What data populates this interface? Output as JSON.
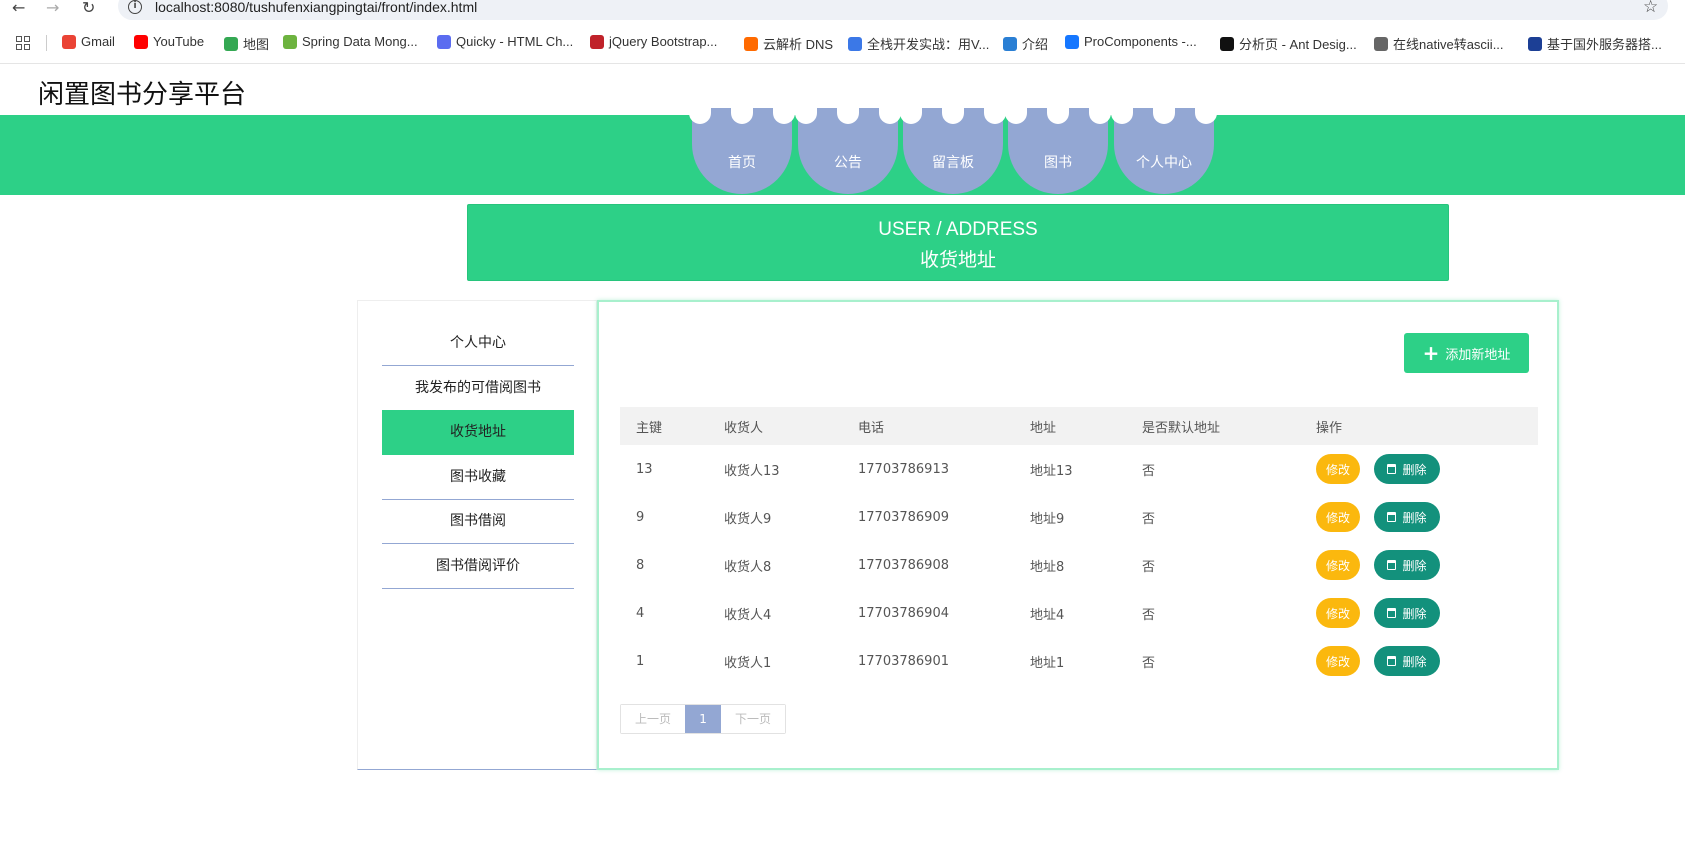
{
  "browser": {
    "url": "localhost:8080/tushufenxiangpingtai/front/index.html",
    "bookmarks": [
      {
        "label": "Gmail",
        "icon": "gmail-icon",
        "color": "#ea4335"
      },
      {
        "label": "YouTube",
        "icon": "youtube-icon",
        "color": "#ff0000"
      },
      {
        "label": "地图",
        "icon": "maps-icon",
        "color": "#34a853"
      },
      {
        "label": "Spring Data Mong...",
        "icon": "spring-icon",
        "color": "#6db33f"
      },
      {
        "label": "Quicky - HTML Ch...",
        "icon": "quicky-icon",
        "color": "#5b6cf0"
      },
      {
        "label": "jQuery Bootstrap...",
        "icon": "jquery-icon",
        "color": "#c0222a"
      },
      {
        "label": "云解析 DNS",
        "icon": "aliyun-icon",
        "color": "#ff6a00"
      },
      {
        "label": "全栈开发实战：用V...",
        "icon": "m-icon",
        "color": "#3b78e7"
      },
      {
        "label": "介绍",
        "icon": "globe-icon",
        "color": "#2a7fd4"
      },
      {
        "label": "ProComponents -...",
        "icon": "antd-icon",
        "color": "#1677ff"
      },
      {
        "label": "分析页 - Ant Desig...",
        "icon": "pro-icon",
        "color": "#111111"
      },
      {
        "label": "在线native转ascii...",
        "icon": "globe-icon",
        "color": "#666666"
      },
      {
        "label": "基于国外服务器搭...",
        "icon": "site-icon",
        "color": "#1c3f95"
      }
    ]
  },
  "site": {
    "title": "闲置图书分享平台",
    "nav": [
      "首页",
      "公告",
      "留言板",
      "图书",
      "个人中心"
    ]
  },
  "banner": {
    "en": "USER / ADDRESS",
    "zh": "收货地址"
  },
  "sidebar": {
    "items": [
      "个人中心",
      "我发布的可借阅图书",
      "收货地址",
      "图书收藏",
      "图书借阅",
      "图书借阅评价"
    ],
    "active_index": 2
  },
  "content": {
    "add_button": "添加新地址",
    "columns": [
      "主键",
      "收货人",
      "电话",
      "地址",
      "是否默认地址",
      "操作"
    ],
    "rows": [
      {
        "id": "13",
        "name": "收货人13",
        "phone": "17703786913",
        "address": "地址13",
        "is_default": "否"
      },
      {
        "id": "9",
        "name": "收货人9",
        "phone": "17703786909",
        "address": "地址9",
        "is_default": "否"
      },
      {
        "id": "8",
        "name": "收货人8",
        "phone": "17703786908",
        "address": "地址8",
        "is_default": "否"
      },
      {
        "id": "4",
        "name": "收货人4",
        "phone": "17703786904",
        "address": "地址4",
        "is_default": "否"
      },
      {
        "id": "1",
        "name": "收货人1",
        "phone": "17703786901",
        "address": "地址1",
        "is_default": "否"
      }
    ],
    "edit_label": "修改",
    "delete_label": "删除",
    "pager": {
      "prev": "上一页",
      "current": "1",
      "next": "下一页"
    }
  },
  "colors": {
    "primary": "#2dd087",
    "nav_tab": "#93a7d3",
    "edit": "#fbb80e",
    "delete": "#13917c"
  }
}
